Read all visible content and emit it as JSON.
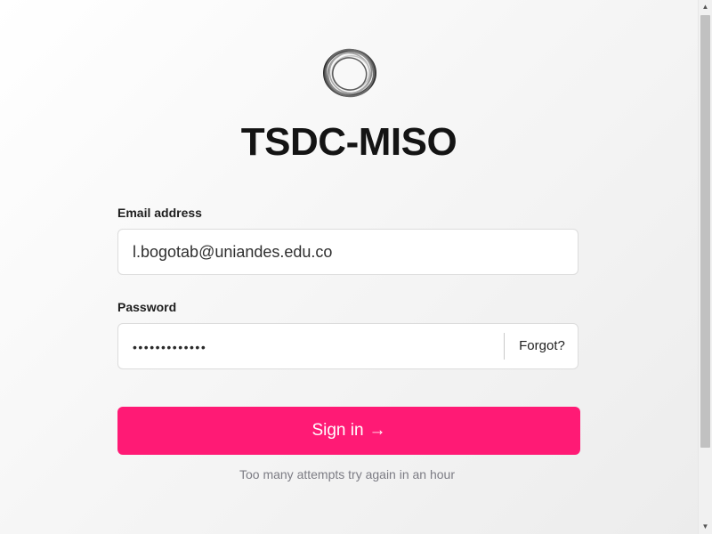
{
  "app": {
    "title": "TSDC-MISO",
    "logo_icon": "ring-logo-icon"
  },
  "form": {
    "email": {
      "label": "Email address",
      "value": "l.bogotab@uniandes.edu.co"
    },
    "password": {
      "label": "Password",
      "masked_value": "•••••••••••••",
      "forgot_label": "Forgot?"
    },
    "submit": {
      "label": "Sign in",
      "icon": "arrow-right-icon",
      "arrow": "→",
      "color": "#ff1a75"
    },
    "status_message": "Too many attempts try again in an hour"
  },
  "scrollbar": {
    "up_arrow": "▲",
    "down_arrow": "▼"
  }
}
